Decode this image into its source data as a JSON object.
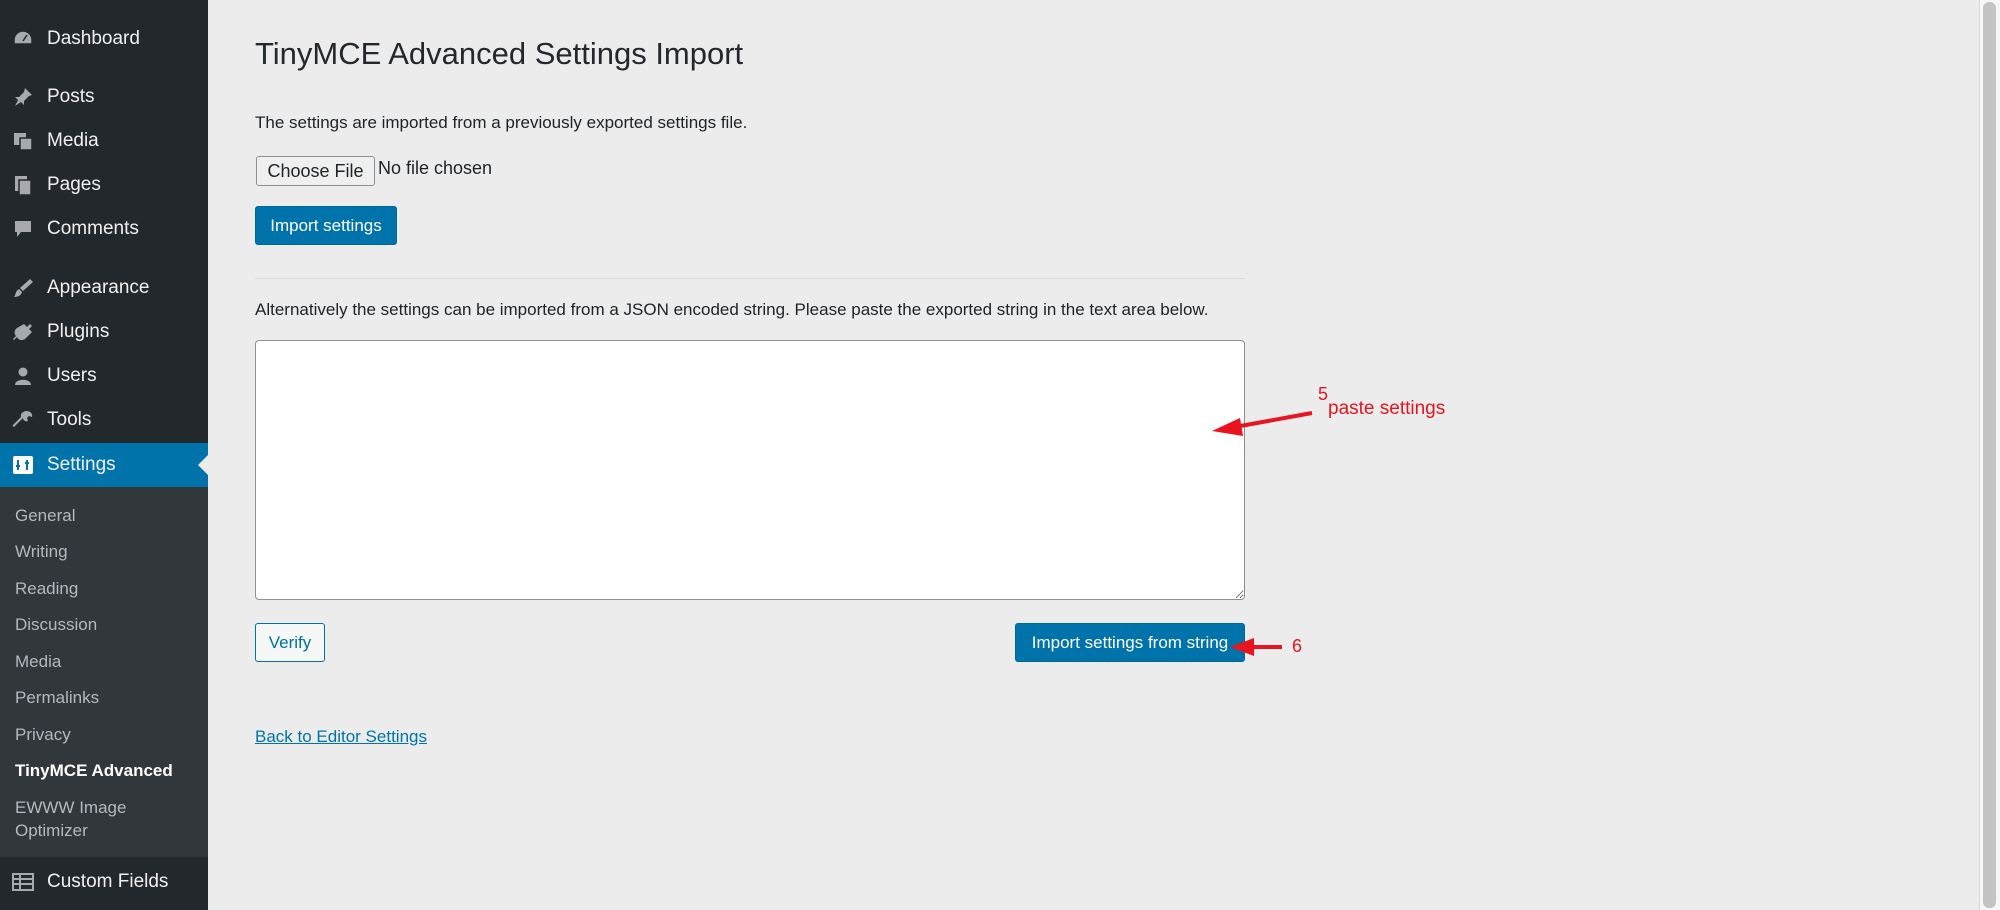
{
  "sidebar": {
    "items": [
      {
        "label": "Dashboard",
        "icon": "dashboard-icon"
      },
      {
        "label": "Posts",
        "icon": "pin-icon"
      },
      {
        "label": "Media",
        "icon": "media-icon"
      },
      {
        "label": "Pages",
        "icon": "pages-icon"
      },
      {
        "label": "Comments",
        "icon": "comment-icon"
      },
      {
        "label": "Appearance",
        "icon": "brush-icon"
      },
      {
        "label": "Plugins",
        "icon": "plugin-icon"
      },
      {
        "label": "Users",
        "icon": "user-icon"
      },
      {
        "label": "Tools",
        "icon": "wrench-icon"
      },
      {
        "label": "Settings",
        "icon": "settings-icon",
        "active": true
      },
      {
        "label": "Custom Fields",
        "icon": "table-icon"
      }
    ],
    "submenu": [
      {
        "label": "General"
      },
      {
        "label": "Writing"
      },
      {
        "label": "Reading"
      },
      {
        "label": "Discussion"
      },
      {
        "label": "Media"
      },
      {
        "label": "Permalinks"
      },
      {
        "label": "Privacy"
      },
      {
        "label": "TinyMCE Advanced",
        "current": true
      },
      {
        "label": "EWWW Image",
        "label2": "Optimizer"
      }
    ]
  },
  "page": {
    "title": "TinyMCE Advanced Settings Import",
    "file_description": "The settings are imported from a previously exported settings file.",
    "choose_file_label": "Choose File",
    "file_status": "No file chosen",
    "import_button": "Import settings",
    "json_description": "Alternatively the settings can be imported from a JSON encoded string. Please paste the exported string in the text area below.",
    "textarea_value": "",
    "verify_button": "Verify",
    "import_string_button": "Import settings from string",
    "back_link": "Back to Editor Settings"
  },
  "annotations": {
    "step5_number": "5",
    "step5_text": "paste settings",
    "step6_number": "6",
    "color": "#e8141f"
  },
  "colors": {
    "sidebar_bg": "#23282d",
    "submenu_bg": "#32373c",
    "accent": "#0073aa",
    "content_bg": "#ececec"
  }
}
